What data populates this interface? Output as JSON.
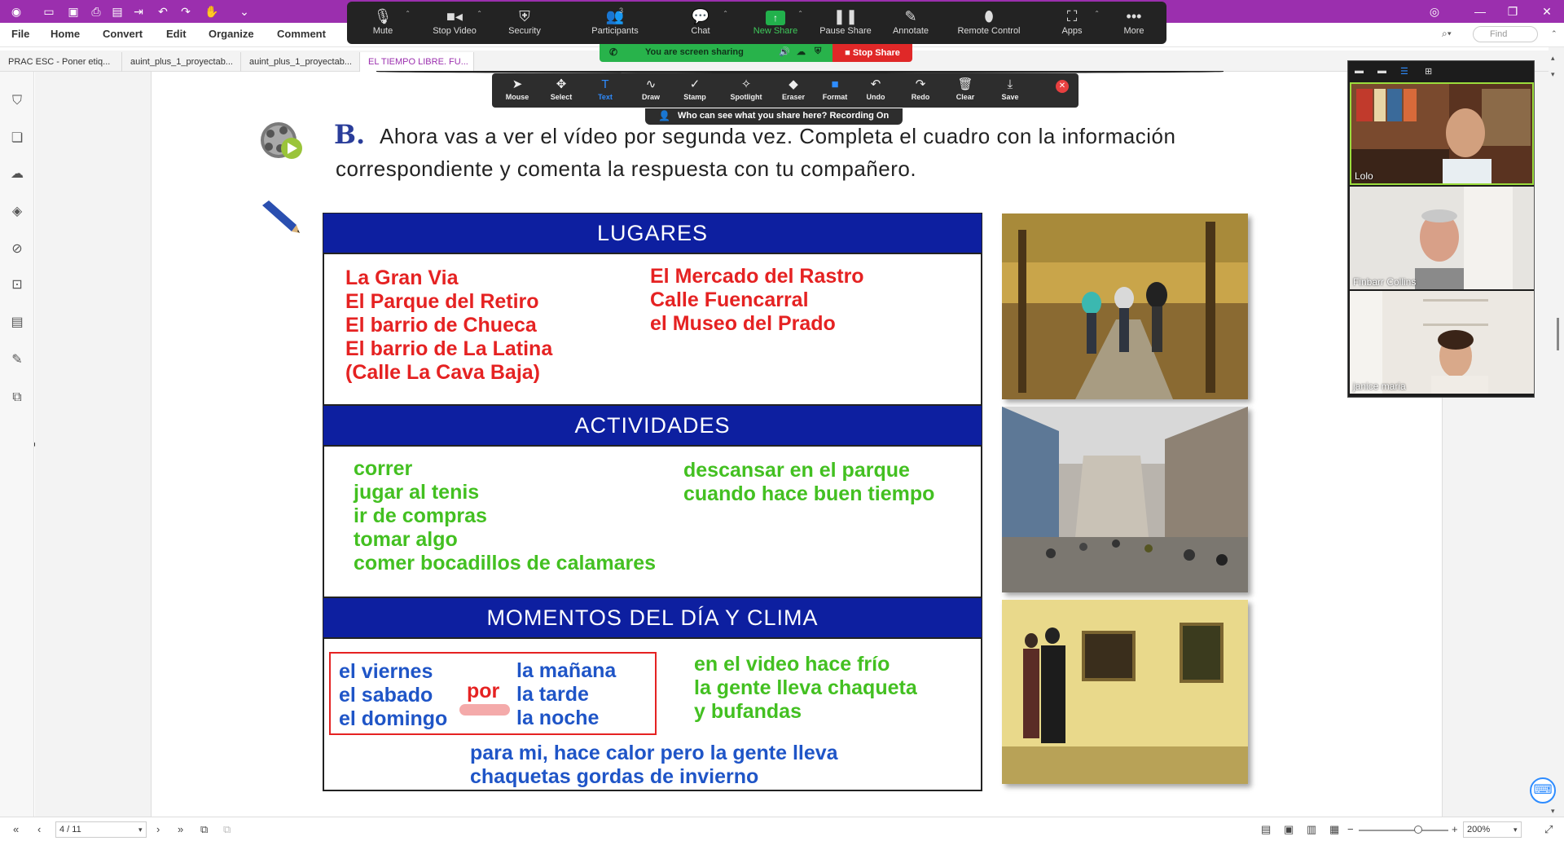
{
  "menubar": {
    "items": [
      "File",
      "Home",
      "Convert",
      "Edit",
      "Organize",
      "Comment"
    ],
    "find_placeholder": "Find"
  },
  "tabs": [
    {
      "label": "PRAC ESC - Poner etiq...",
      "active": false
    },
    {
      "label": "auint_plus_1_proyectab...",
      "active": false
    },
    {
      "label": "auint_plus_1_proyectab...",
      "active": false
    },
    {
      "label": "EL TIEMPO LIBRE. FU...",
      "active": true
    }
  ],
  "zoom_toolbar": {
    "buttons": [
      {
        "label": "Mute",
        "icon": "microphone-icon"
      },
      {
        "label": "Stop Video",
        "icon": "video-camera-icon"
      },
      {
        "label": "Security",
        "icon": "shield-icon"
      },
      {
        "label": "Participants",
        "icon": "participants-icon",
        "count": "3"
      },
      {
        "label": "Chat",
        "icon": "chat-icon"
      },
      {
        "label": "New Share",
        "icon": "share-screen-icon"
      },
      {
        "label": "Pause Share",
        "icon": "pause-icon"
      },
      {
        "label": "Annotate",
        "icon": "pen-icon"
      },
      {
        "label": "Remote Control",
        "icon": "mouse-icon"
      },
      {
        "label": "Apps",
        "icon": "apps-icon"
      },
      {
        "label": "More",
        "icon": "more-icon"
      }
    ],
    "sharing_status": "You are screen sharing",
    "stop_share": "Stop Share"
  },
  "annotation_toolbar": {
    "tools": [
      "Mouse",
      "Select",
      "Text",
      "Draw",
      "Stamp",
      "Spotlight",
      "Eraser",
      "Format",
      "Undo",
      "Redo",
      "Clear",
      "Save"
    ],
    "active_tool": "Text",
    "share_notice": "Who can see what you share here? Recording On"
  },
  "document": {
    "letter": "B.",
    "instruction_line1": "Ahora vas a ver el vídeo por segunda vez. Completa el cuadro con la información",
    "instruction_line2": "correspondiente y comenta la respuesta con tu compañero.",
    "sections": {
      "lugares": {
        "title": "LUGARES",
        "left": [
          "La Gran Via",
          "El Parque del Retiro",
          "El barrio de Chueca",
          "El barrio de La Latina",
          "(Calle La Cava Baja)"
        ],
        "right": [
          "El Mercado del Rastro",
          "Calle Fuencarral",
          "el Museo del Prado"
        ]
      },
      "actividades": {
        "title": "ACTIVIDADES",
        "left": [
          "correr",
          "jugar al tenis",
          "ir de compras",
          "tomar algo",
          "comer bocadillos de calamares"
        ],
        "right": [
          "descansar en el parque",
          "cuando hace buen tiempo"
        ]
      },
      "momentos": {
        "title": "MOMENTOS DEL DÍA Y CLIMA",
        "days": [
          "el viernes",
          "el sabado",
          "el domingo"
        ],
        "connector": "por",
        "times": [
          "la mañana",
          "la tarde",
          "la noche"
        ],
        "right": [
          "en el video hace frío",
          "la gente lleva chaqueta",
          "y bufandas"
        ],
        "bottom": [
          "para mi, hace calor pero la gente lleva",
          "chaquetas gordas de invierno"
        ]
      }
    }
  },
  "participants": [
    {
      "name": "Lolo"
    },
    {
      "name": "Finbarr Collins"
    },
    {
      "name": "janice maria"
    }
  ],
  "statusbar": {
    "page": "4 / 11",
    "zoom": "200%"
  },
  "colors": {
    "title_bar": "#9b2fae",
    "table_header": "#0d1fa0",
    "red_text": "#e52222",
    "green_text": "#43c021",
    "blue_text": "#1f55c7"
  }
}
